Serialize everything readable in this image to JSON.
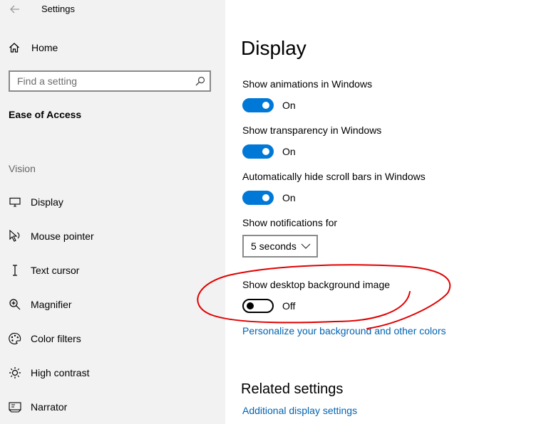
{
  "window": {
    "title": "Settings"
  },
  "sidebar": {
    "home_label": "Home",
    "search_placeholder": "Find a setting",
    "section_title": "Ease of Access",
    "group_label": "Vision",
    "items": [
      {
        "label": "Display",
        "icon": "monitor-icon"
      },
      {
        "label": "Mouse pointer",
        "icon": "mouse-pointer-icon"
      },
      {
        "label": "Text cursor",
        "icon": "text-cursor-icon"
      },
      {
        "label": "Magnifier",
        "icon": "magnifier-icon"
      },
      {
        "label": "Color filters",
        "icon": "color-filters-icon"
      },
      {
        "label": "High contrast",
        "icon": "high-contrast-icon"
      },
      {
        "label": "Narrator",
        "icon": "narrator-icon"
      }
    ]
  },
  "main": {
    "title": "Display",
    "settings": [
      {
        "label": "Show animations in Windows",
        "state": "On",
        "on": true
      },
      {
        "label": "Show transparency in Windows",
        "state": "On",
        "on": true
      },
      {
        "label": "Automatically hide scroll bars in Windows",
        "state": "On",
        "on": true
      }
    ],
    "notifications": {
      "label": "Show notifications for",
      "value": "5 seconds"
    },
    "background": {
      "label": "Show desktop background image",
      "state": "Off",
      "on": false
    },
    "personalize_link": "Personalize your background and other colors",
    "related_heading": "Related settings",
    "related_link": "Additional display settings"
  },
  "colors": {
    "accent": "#0078d7",
    "link": "#0063b1",
    "annotation": "#e00000"
  }
}
